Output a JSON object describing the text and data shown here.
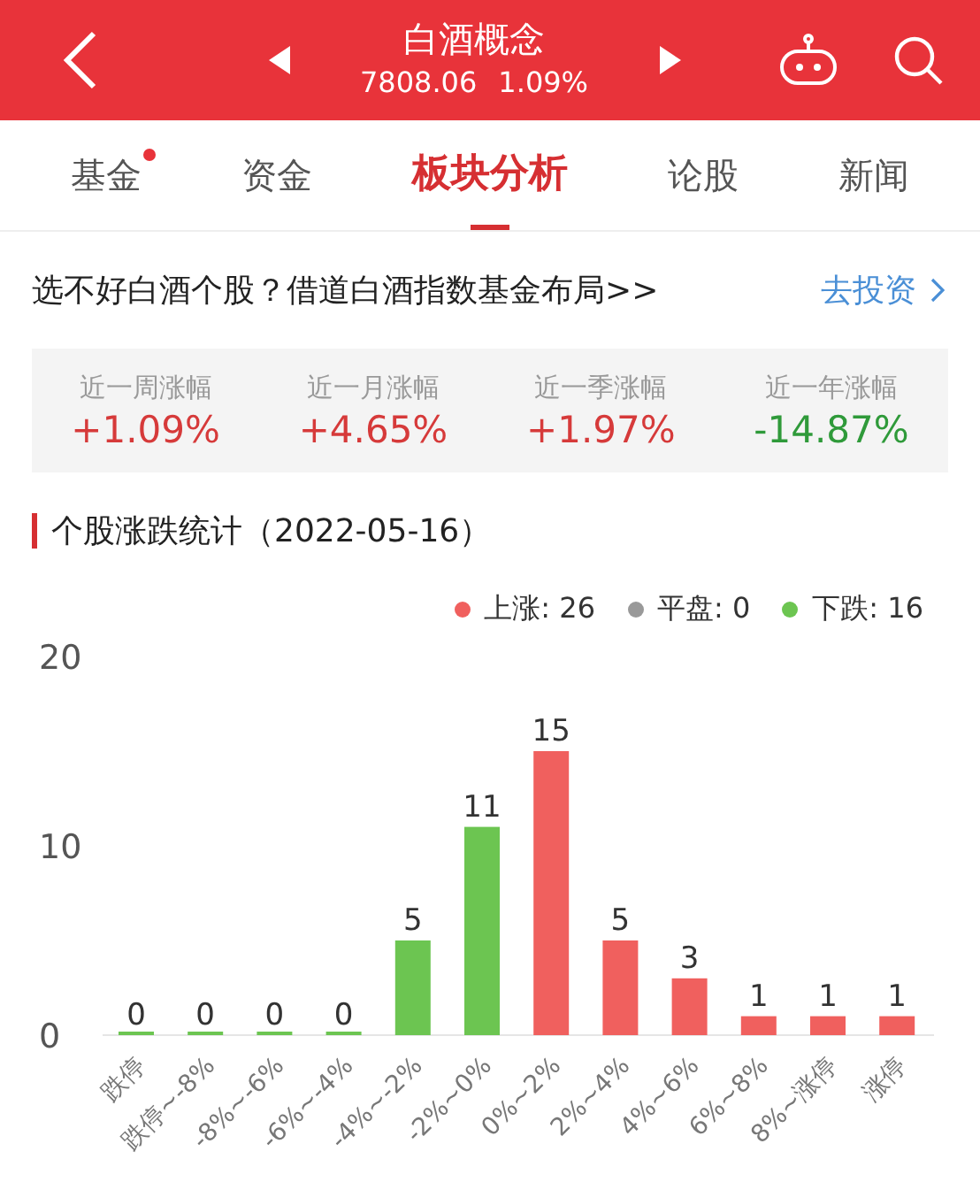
{
  "header": {
    "title": "白酒概念",
    "price": "7808.06",
    "change": "1.09%"
  },
  "tabs": [
    {
      "label": "基金",
      "selected": false,
      "dot": true
    },
    {
      "label": "资金",
      "selected": false,
      "dot": false
    },
    {
      "label": "板块分析",
      "selected": true,
      "dot": false
    },
    {
      "label": "论股",
      "selected": false,
      "dot": false
    },
    {
      "label": "新闻",
      "selected": false,
      "dot": false
    }
  ],
  "promo": {
    "text": "选不好白酒个股？借道白酒指数基金布局>>",
    "link": "去投资"
  },
  "stats": [
    {
      "label": "近一周涨幅",
      "value": "+1.09%",
      "rising": true
    },
    {
      "label": "近一月涨幅",
      "value": "+4.65%",
      "rising": true
    },
    {
      "label": "近一季涨幅",
      "value": "+1.97%",
      "rising": true
    },
    {
      "label": "近一年涨幅",
      "value": "-14.87%",
      "rising": false
    }
  ],
  "section": {
    "title": "个股涨跌统计（2022-05-16）"
  },
  "legend": [
    {
      "label": "上涨: 26",
      "color": "#f0605e"
    },
    {
      "label": "平盘: 0",
      "color": "#999999"
    },
    {
      "label": "下跌: 16",
      "color": "#6cc551"
    }
  ],
  "chart_data": {
    "type": "bar",
    "categories": [
      "跌停",
      "跌停~-8%",
      "-8%~-6%",
      "-6%~-4%",
      "-4%~-2%",
      "-2%~0%",
      "0%~2%",
      "2%~4%",
      "4%~6%",
      "6%~8%",
      "8%~涨停",
      "涨停"
    ],
    "series": [
      {
        "color": "#6cc551",
        "values": [
          0,
          0,
          0,
          0,
          5,
          11,
          null,
          null,
          null,
          null,
          null,
          null
        ]
      },
      {
        "color": "#f0605e",
        "values": [
          null,
          null,
          null,
          null,
          null,
          null,
          15,
          5,
          3,
          1,
          1,
          1
        ]
      }
    ],
    "ylim": [
      0,
      20
    ],
    "yticks": [
      0,
      10,
      20
    ],
    "stacked": true,
    "data_labels": true
  }
}
